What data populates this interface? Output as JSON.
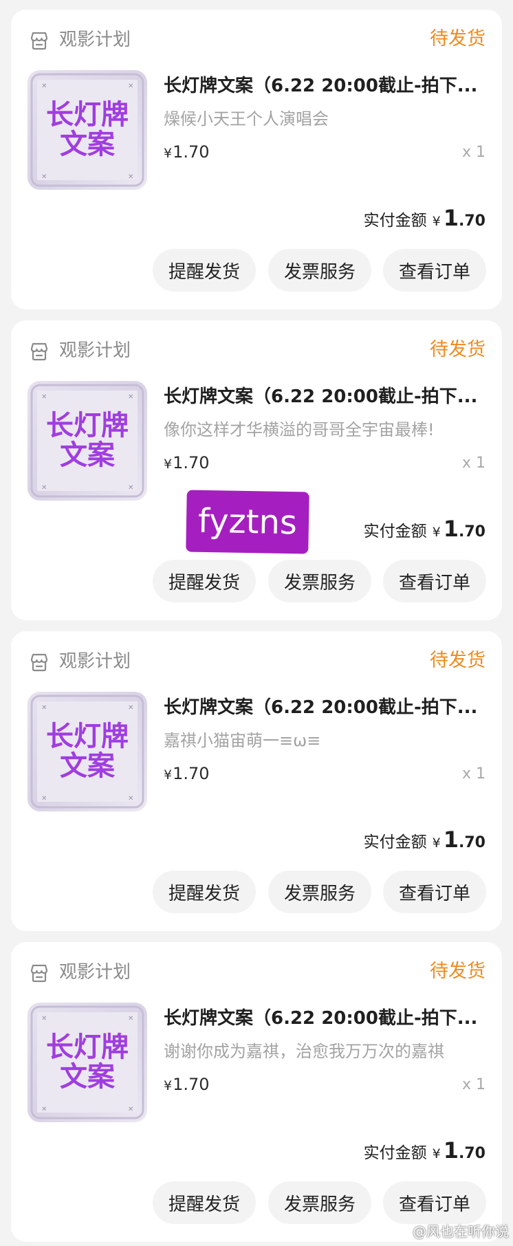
{
  "colors": {
    "page_background": "#f3f3f3",
    "card_background": "#ffffff",
    "status_orange": "#f08a1e",
    "thumb_text_purple": "#a03de0",
    "sticker_purple": "#a51fc0",
    "button_background": "#f3f3f3"
  },
  "orders": [
    {
      "shop_icon": "shop-icon",
      "shop_name": "观影计划",
      "status": "待发货",
      "thumb_line1": "长灯牌",
      "thumb_line2": "文案",
      "title": "长灯牌文案（6.22 20:00截止-拍下...",
      "spec": "燥候小天王个人演唱会",
      "unit_currency": "¥",
      "unit_price": "1.70",
      "quantity": "x 1",
      "paid_label": "实付金额",
      "paid_currency": "¥",
      "paid_int": "1",
      "paid_dec": ".70",
      "buttons": {
        "remind": "提醒发货",
        "invoice": "发票服务",
        "view": "查看订单"
      }
    },
    {
      "shop_icon": "shop-icon",
      "shop_name": "观影计划",
      "status": "待发货",
      "thumb_line1": "长灯牌",
      "thumb_line2": "文案",
      "title": "长灯牌文案（6.22 20:00截止-拍下...",
      "spec": "像你这样才华横溢的哥哥全宇宙最棒!",
      "unit_currency": "¥",
      "unit_price": "1.70",
      "quantity": "x 1",
      "paid_label": "实付金额",
      "paid_currency": "¥",
      "paid_int": "1",
      "paid_dec": ".70",
      "buttons": {
        "remind": "提醒发货",
        "invoice": "发票服务",
        "view": "查看订单"
      }
    },
    {
      "shop_icon": "shop-icon",
      "shop_name": "观影计划",
      "status": "待发货",
      "thumb_line1": "长灯牌",
      "thumb_line2": "文案",
      "title": "长灯牌文案（6.22 20:00截止-拍下...",
      "spec": "嘉祺小猫宙萌一≡ω≡",
      "unit_currency": "¥",
      "unit_price": "1.70",
      "quantity": "x 1",
      "paid_label": "实付金额",
      "paid_currency": "¥",
      "paid_int": "1",
      "paid_dec": ".70",
      "buttons": {
        "remind": "提醒发货",
        "invoice": "发票服务",
        "view": "查看订单"
      }
    },
    {
      "shop_icon": "shop-icon",
      "shop_name": "观影计划",
      "status": "待发货",
      "thumb_line1": "长灯牌",
      "thumb_line2": "文案",
      "title": "长灯牌文案（6.22 20:00截止-拍下...",
      "spec": "谢谢你成为嘉祺，治愈我万万次的嘉祺",
      "unit_currency": "¥",
      "unit_price": "1.70",
      "quantity": "x 1",
      "paid_label": "实付金额",
      "paid_currency": "¥",
      "paid_int": "1",
      "paid_dec": ".70",
      "buttons": {
        "remind": "提醒发货",
        "invoice": "发票服务",
        "view": "查看订单"
      }
    }
  ],
  "sticker": {
    "text": "fyztns"
  },
  "watermark": {
    "icon": "weibo-logo-icon",
    "text": "@风也在听你说"
  }
}
